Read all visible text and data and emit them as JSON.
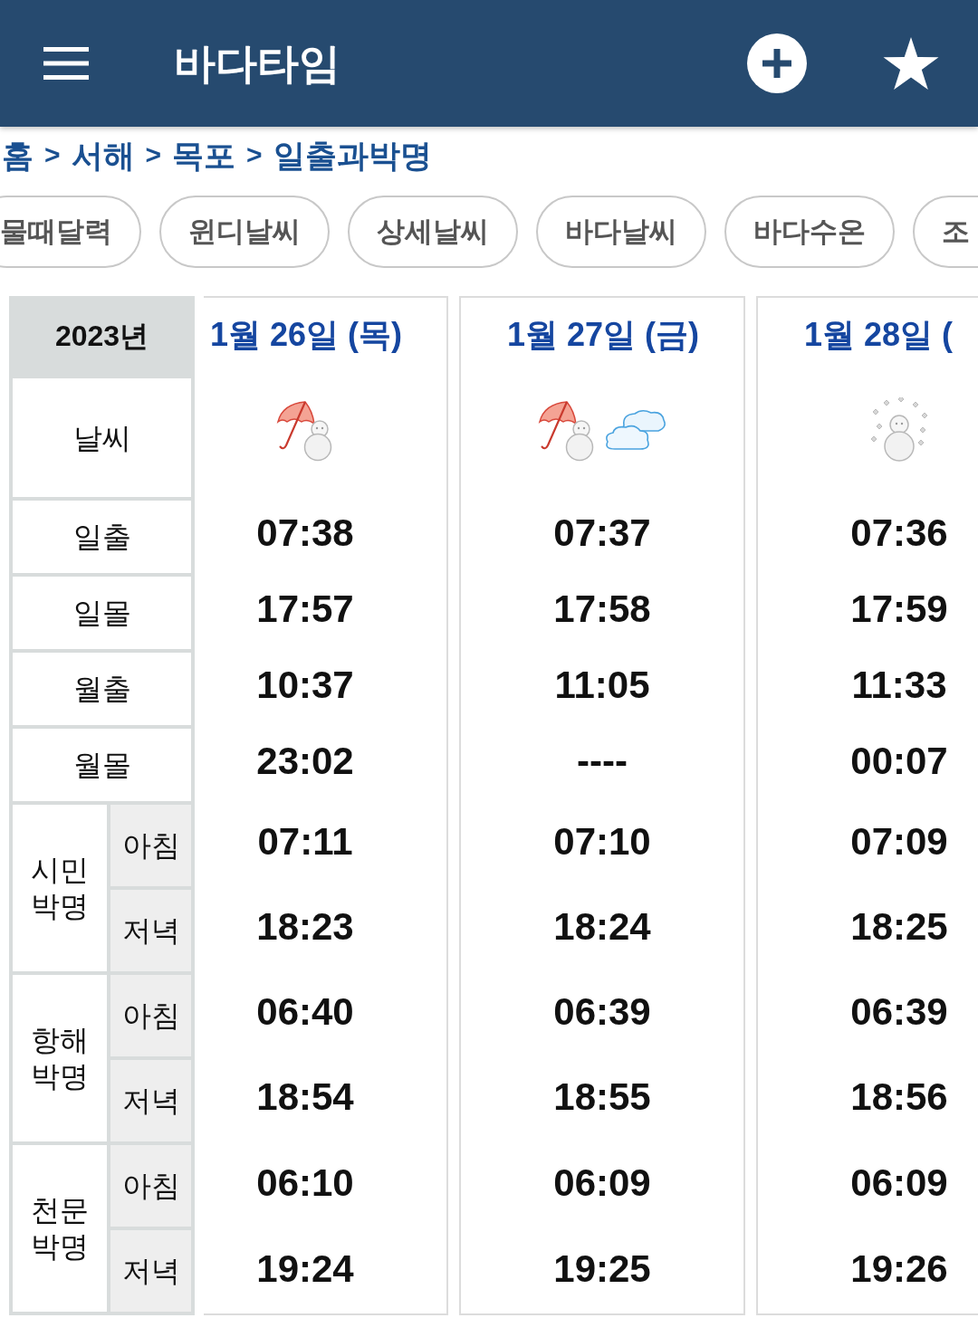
{
  "app_bar": {
    "title": "바다타임"
  },
  "breadcrumb": {
    "separator": ">",
    "items": [
      "홈",
      "서해",
      "목포",
      "일출과박명"
    ]
  },
  "chips": [
    "물때달력",
    "윈디날씨",
    "상세날씨",
    "바다날씨",
    "바다수온",
    "조"
  ],
  "table": {
    "year": "2023년",
    "days": [
      {
        "date": "1월 26일 (목)",
        "weather": [
          {
            "kind": "rain_snow"
          }
        ]
      },
      {
        "date": "1월 27일 (금)",
        "weather": [
          {
            "kind": "rain_snow"
          },
          {
            "kind": "cloudy"
          }
        ]
      },
      {
        "date": "1월 28일 (",
        "weather": [
          {
            "kind": "snow"
          }
        ]
      }
    ],
    "weather_row": {
      "label": "날씨"
    },
    "rows": [
      {
        "label": "일출",
        "values": [
          "07:38",
          "07:37",
          "07:36"
        ]
      },
      {
        "label": "일몰",
        "values": [
          "17:57",
          "17:58",
          "17:59"
        ]
      },
      {
        "label": "월출",
        "values": [
          "10:37",
          "11:05",
          "11:33"
        ]
      },
      {
        "label": "월몰",
        "values": [
          "23:02",
          "----",
          "00:07"
        ]
      }
    ],
    "twilight": [
      {
        "label": "시민 박명",
        "periods": [
          {
            "label": "아침",
            "values": [
              "07:11",
              "07:10",
              "07:09"
            ]
          },
          {
            "label": "저녁",
            "values": [
              "18:23",
              "18:24",
              "18:25"
            ]
          }
        ]
      },
      {
        "label": "항해 박명",
        "periods": [
          {
            "label": "아침",
            "values": [
              "06:40",
              "06:39",
              "06:39"
            ]
          },
          {
            "label": "저녁",
            "values": [
              "18:54",
              "18:55",
              "18:56"
            ]
          }
        ]
      },
      {
        "label": "천문 박명",
        "periods": [
          {
            "label": "아침",
            "values": [
              "06:10",
              "06:09",
              "06:09"
            ]
          },
          {
            "label": "저녁",
            "values": [
              "19:24",
              "19:25",
              "19:26"
            ]
          }
        ]
      }
    ]
  }
}
